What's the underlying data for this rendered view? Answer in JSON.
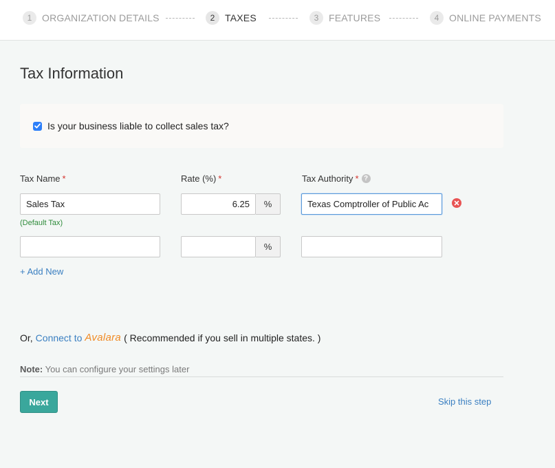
{
  "stepper": {
    "steps": [
      {
        "num": "1",
        "label": "ORGANIZATION DETAILS"
      },
      {
        "num": "2",
        "label": "TAXES"
      },
      {
        "num": "3",
        "label": "FEATURES"
      },
      {
        "num": "4",
        "label": "ONLINE PAYMENTS"
      }
    ],
    "active_index": 1
  },
  "page": {
    "title": "Tax Information"
  },
  "liable": {
    "checked": true,
    "label": "Is your business liable to collect sales tax?"
  },
  "columns": {
    "tax_name": "Tax Name",
    "rate": "Rate (%)",
    "tax_authority": "Tax Authority",
    "required_mark": "*",
    "help_icon": "question-circle-icon"
  },
  "rows": [
    {
      "tax_name": "Sales Tax",
      "rate": "6.25",
      "rate_unit": "%",
      "tax_authority": "Texas Comptroller of Public Ac",
      "note": "(Default Tax)"
    },
    {
      "tax_name": "",
      "rate": "",
      "rate_unit": "%",
      "tax_authority": ""
    }
  ],
  "add_new": "+ Add New",
  "connect": {
    "prefix": "Or,",
    "link": "Connect to",
    "brand": "Avalara",
    "suffix": "( Recommended if you sell in multiple states. )"
  },
  "note": {
    "label": "Note:",
    "text": " You can configure your settings later"
  },
  "actions": {
    "next": "Next",
    "skip": "Skip this step"
  },
  "colors": {
    "accent": "#3aa79c",
    "link": "#3a7fc1",
    "avalara": "#f08a24",
    "remove": "#e85454",
    "checkbox": "#2d7ff9"
  }
}
